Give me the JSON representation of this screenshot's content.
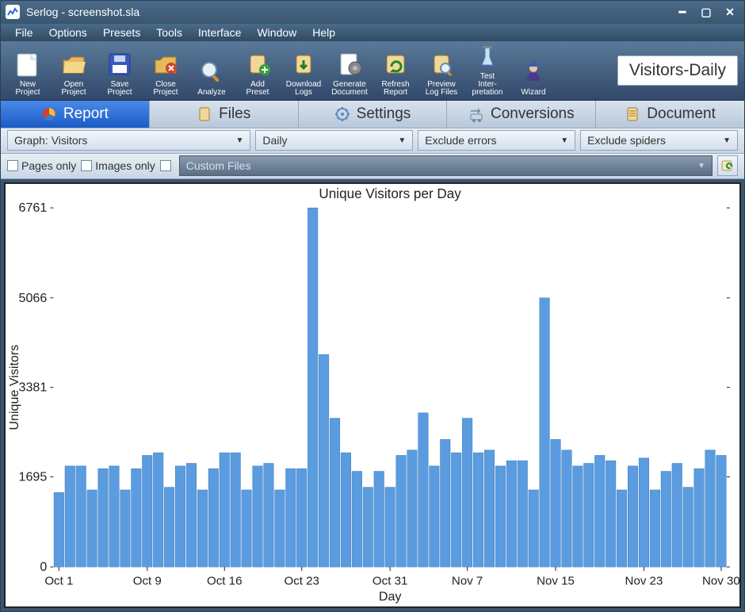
{
  "window": {
    "title": "Serlog - screenshot.sla"
  },
  "menu": [
    "File",
    "Options",
    "Presets",
    "Tools",
    "Interface",
    "Window",
    "Help"
  ],
  "toolbar": [
    {
      "name": "new-project",
      "label": "New Project"
    },
    {
      "name": "open-project",
      "label": "Open Project"
    },
    {
      "name": "save-project",
      "label": "Save Project"
    },
    {
      "name": "close-project",
      "label": "Close Project"
    },
    {
      "name": "analyze",
      "label": "Analyze"
    },
    {
      "name": "add-preset",
      "label": "Add Preset"
    },
    {
      "name": "download-logs",
      "label": "Download Logs"
    },
    {
      "name": "generate-document",
      "label": "Generate Document"
    },
    {
      "name": "refresh-report",
      "label": "Refresh Report"
    },
    {
      "name": "preview-log-files",
      "label": "Preview Log Files"
    },
    {
      "name": "test-interpretation",
      "label": "Test Inter-pretation"
    },
    {
      "name": "wizard",
      "label": "Wizard"
    }
  ],
  "side_label": "Visitors-Daily",
  "tabs": [
    {
      "name": "report",
      "label": "Report",
      "active": true
    },
    {
      "name": "files",
      "label": "Files",
      "active": false
    },
    {
      "name": "settings",
      "label": "Settings",
      "active": false
    },
    {
      "name": "conversions",
      "label": "Conversions",
      "active": false
    },
    {
      "name": "document",
      "label": "Document",
      "active": false
    }
  ],
  "filters": {
    "graph": "Graph: Visitors",
    "period": "Daily",
    "errors": "Exclude errors",
    "spiders": "Exclude spiders"
  },
  "options": {
    "pages_only": "Pages only",
    "images_only": "Images only",
    "blank": " ",
    "custom_files": "Custom Files"
  },
  "chart_data": {
    "type": "bar",
    "title": "Unique Visitors per Day",
    "xlabel": "Day",
    "ylabel": "Unique Visitors",
    "yticks": [
      0,
      1695,
      3381,
      5066,
      6761
    ],
    "xtick_positions": [
      0,
      8,
      15,
      22,
      30,
      37,
      45,
      53,
      60
    ],
    "xtick_labels": [
      "Oct 1",
      "Oct 9",
      "Oct 16",
      "Oct 23",
      "Oct 31",
      "Nov 7",
      "Nov 15",
      "Nov 23",
      "Nov 30"
    ],
    "values": [
      1400,
      1900,
      1900,
      1450,
      1850,
      1900,
      1450,
      1850,
      2100,
      2150,
      1500,
      1900,
      1950,
      1450,
      1850,
      2150,
      2150,
      1450,
      1900,
      1950,
      1450,
      1850,
      1850,
      6761,
      4000,
      2800,
      2150,
      1800,
      1500,
      1800,
      1500,
      2100,
      2200,
      2900,
      1900,
      2400,
      2150,
      2800,
      2150,
      2200,
      1900,
      2000,
      2000,
      1450,
      5066,
      2400,
      2200,
      1900,
      1950,
      2100,
      2000,
      1450,
      1900,
      2050,
      1450,
      1800,
      1950,
      1500,
      1850,
      2200,
      2100
    ]
  }
}
